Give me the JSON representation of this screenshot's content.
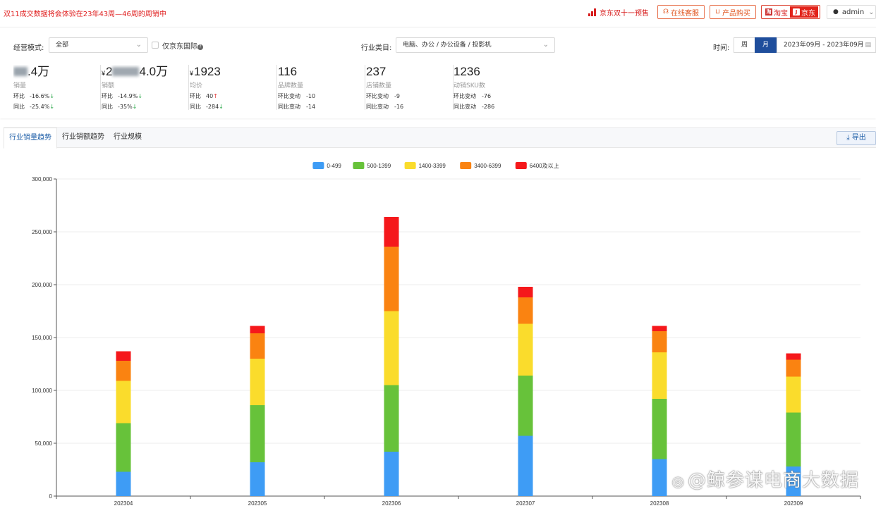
{
  "topbar": {
    "notice": "双11成交数据将会体验在23年43周—46周的周销中",
    "preview_label": "京东双十一预售",
    "service_label": "在线客服",
    "purchase_label": "产品购买",
    "platform_taobao": "淘宝",
    "platform_jd": "京东",
    "user": "admin"
  },
  "filters": {
    "mode_label": "经营模式:",
    "mode_value": "全部",
    "jd_intl_label": "仅京东国际",
    "category_label": "行业类目:",
    "category_value": "电脑、办公 / 办公设备 / 投影机",
    "time_label": "时间:",
    "period_week": "周",
    "period_month": "月",
    "period_active": "月",
    "date_range": "2023年09月 - 2023年09月"
  },
  "kpis": [
    {
      "value_prefix": "",
      "value": ".4万",
      "label": "销量",
      "row1_key": "环比",
      "row1_val": "-16.6%",
      "row1_dir": "down",
      "row2_key": "同比",
      "row2_val": "-25.4%",
      "row2_dir": "down"
    },
    {
      "value_prefix": "¥",
      "value": "2",
      "value_suffix": "4.0万",
      "label": "销额",
      "row1_key": "环比",
      "row1_val": "-14.9%",
      "row1_dir": "down",
      "row2_key": "同比",
      "row2_val": "-35%",
      "row2_dir": "down"
    },
    {
      "value_prefix": "¥",
      "value": "1923",
      "label": "均价",
      "row1_key": "环比",
      "row1_val": "40",
      "row1_dir": "up",
      "row2_key": "同比",
      "row2_val": "-284",
      "row2_dir": "down"
    },
    {
      "value_prefix": "",
      "value": "116",
      "label": "品牌数量",
      "row1_key": "环比变动",
      "row1_val": "-10",
      "row1_dir": "",
      "row2_key": "同比变动",
      "row2_val": "-14",
      "row2_dir": ""
    },
    {
      "value_prefix": "",
      "value": "237",
      "label": "店铺数量",
      "row1_key": "环比变动",
      "row1_val": "-9",
      "row1_dir": "",
      "row2_key": "同比变动",
      "row2_val": "-16",
      "row2_dir": ""
    },
    {
      "value_prefix": "",
      "value": "1236",
      "label": "动销SKU数",
      "row1_key": "环比变动",
      "row1_val": "-76",
      "row1_dir": "",
      "row2_key": "同比变动",
      "row2_val": "-286",
      "row2_dir": ""
    }
  ],
  "tabs": [
    {
      "label": "行业销量趋势",
      "active": true
    },
    {
      "label": "行业销额趋势",
      "active": false
    },
    {
      "label": "行业规模",
      "active": false
    }
  ],
  "export_label": "导出",
  "watermark": "@鲸参谋电商大数据",
  "colors": {
    "accent": "#1f4e9c",
    "alert": "#e02020"
  },
  "chart_data": {
    "type": "bar",
    "stacked": true,
    "categories": [
      "202304",
      "202305",
      "202306",
      "202307",
      "202308",
      "202309"
    ],
    "series": [
      {
        "name": "0-499",
        "color": "#3e9cf5",
        "values": [
          23000,
          32000,
          42000,
          57000,
          35000,
          28000
        ]
      },
      {
        "name": "500-1399",
        "color": "#67c23a",
        "values": [
          46000,
          54000,
          63000,
          57000,
          57000,
          51000
        ]
      },
      {
        "name": "1400-3399",
        "color": "#fadc2c",
        "values": [
          40000,
          44000,
          70000,
          49000,
          44000,
          34000
        ]
      },
      {
        "name": "3400-6399",
        "color": "#fa8311",
        "values": [
          19000,
          24000,
          61000,
          25000,
          20000,
          16000
        ]
      },
      {
        "name": "6400及以上",
        "color": "#f5181b",
        "values": [
          9000,
          7000,
          28000,
          10000,
          5000,
          6000
        ]
      }
    ],
    "ylim": [
      0,
      300000
    ],
    "yticks": [
      "0",
      "50,000",
      "100,000",
      "150,000",
      "200,000",
      "250,000",
      "300,000"
    ],
    "grid": true,
    "legend": "top-center"
  }
}
